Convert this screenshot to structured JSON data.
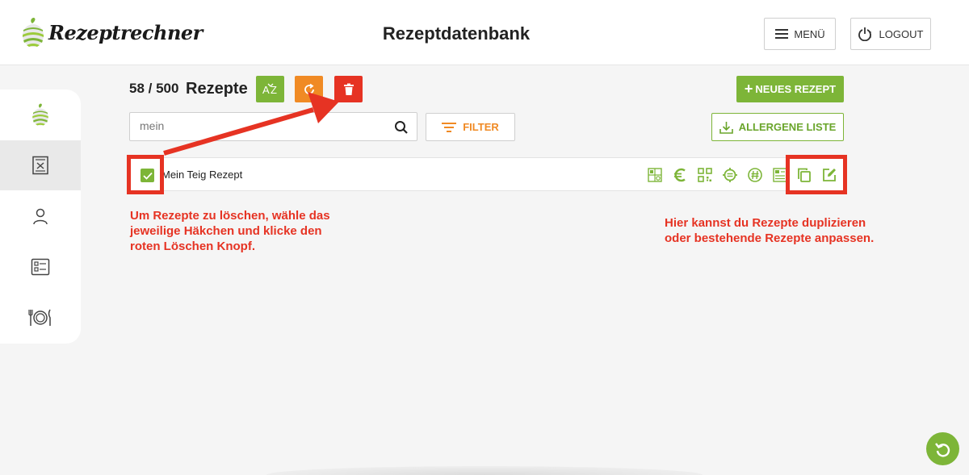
{
  "app": {
    "brand": "Rezeptrechner"
  },
  "header": {
    "title": "Rezeptdatenbank",
    "menu_label": "MENÜ",
    "logout_label": "LOGOUT"
  },
  "toolbar": {
    "count": "58 / 500",
    "count_label": "Rezepte",
    "sort_label": "AZ",
    "new_recipe_label": "NEUES REZEPT"
  },
  "search": {
    "value": "mein",
    "filter_label": "FILTER"
  },
  "allergens": {
    "label": "ALLERGENE LISTE"
  },
  "recipes": [
    {
      "name": "Mein Teig Rezept",
      "checked": true
    }
  ],
  "annotations": {
    "delete_hint": [
      "Um Rezepte zu löschen, wähle das",
      "jeweilige Häkchen und klicke den",
      "roten Löschen Knopf."
    ],
    "duplicate_hint": [
      "Hier kannst du Rezepte duplizieren",
      "oder bestehende Rezepte anpassen."
    ]
  },
  "colors": {
    "green": "#7db538",
    "orange": "#f08a24",
    "red": "#e63323"
  },
  "icons": {
    "sidebar": [
      "apple-logo-icon",
      "recipe-book-icon",
      "user-icon",
      "checklist-icon",
      "plate-cutlery-icon"
    ],
    "row_actions": [
      "nutrition-table-icon",
      "euro-icon",
      "qr-code-icon",
      "settings-badge-icon",
      "allergen-badge-icon",
      "label-icon",
      "duplicate-icon",
      "edit-icon"
    ]
  }
}
